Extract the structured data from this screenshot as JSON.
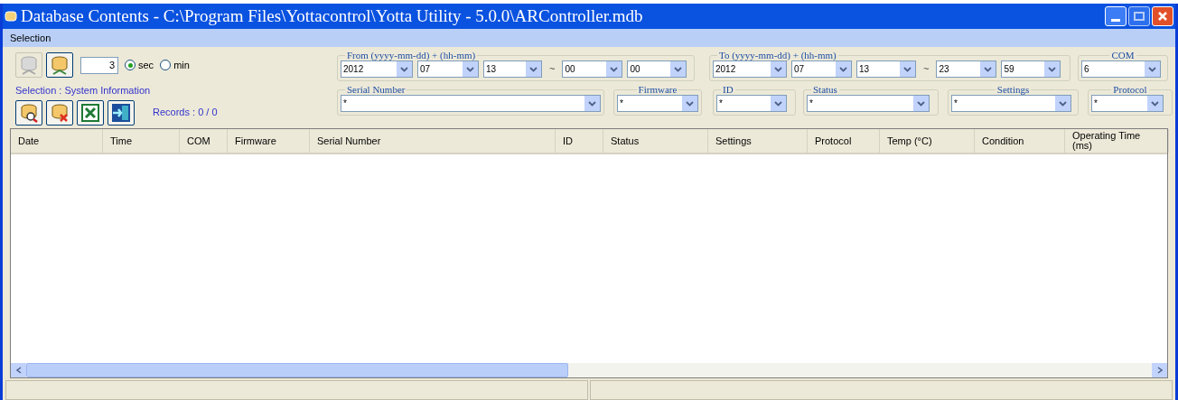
{
  "window": {
    "title": "Database Contents - C:\\Program Files\\Yottacontrol\\Yotta Utility - 5.0.0\\ARController.mdb"
  },
  "menu": [
    {
      "label": "Selection"
    }
  ],
  "toolbar": {
    "connect_buttons": [
      {
        "kind": "disconnect",
        "disabled": true
      },
      {
        "kind": "connect",
        "disabled": false
      }
    ],
    "interval": "3",
    "units": [
      {
        "label": "sec",
        "selected": true
      },
      {
        "label": "min",
        "selected": false
      }
    ],
    "selection_label": "Selection : System Information",
    "actions": [
      {
        "kind": "search"
      },
      {
        "kind": "delete"
      },
      {
        "kind": "excel"
      },
      {
        "kind": "exit"
      }
    ],
    "records": "Records : 0 / 0"
  },
  "filters": {
    "from": {
      "label": "From (yyyy-mm-dd) + (hh-mm)",
      "date": [
        "2012",
        "07",
        "13"
      ],
      "separator": "~",
      "time": [
        "00",
        "00"
      ]
    },
    "to": {
      "label": "To (yyyy-mm-dd) + (hh-mm)",
      "date": [
        "2012",
        "07",
        "13"
      ],
      "separator": "~",
      "time": [
        "23",
        "59"
      ]
    },
    "com": {
      "label": "COM",
      "value": "6"
    },
    "fields": [
      {
        "label": "Serial Number",
        "value": "*"
      },
      {
        "label": "Firmware",
        "value": "*"
      },
      {
        "label": "ID",
        "value": "*"
      },
      {
        "label": "Status",
        "value": "*"
      },
      {
        "label": "Settings",
        "value": "*"
      },
      {
        "label": "Protocol",
        "value": "*"
      }
    ]
  },
  "table": {
    "columns": [
      "Date",
      "Time",
      "COM",
      "Firmware",
      "Serial Number",
      "ID",
      "Status",
      "Settings",
      "Protocol",
      "Temp (°C)",
      "Condition",
      "Operating Time (ms)"
    ]
  }
}
